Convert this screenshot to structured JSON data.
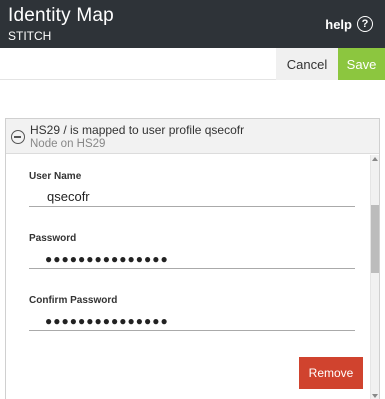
{
  "header": {
    "title": "Identity Map",
    "subtitle": "STITCH",
    "help_label": "help",
    "help_icon": "question-circle-icon"
  },
  "actions": {
    "cancel_label": "Cancel",
    "save_label": "Save",
    "save_color": "#8cc63f"
  },
  "mapping": {
    "title": "HS29 / is mapped to user profile qsecofr",
    "subtitle": "Node on HS29",
    "collapse_icon": "minus-circle-icon",
    "fields": {
      "username_label": "User Name",
      "username_value": "qsecofr",
      "password_label": "Password",
      "password_value": "●●●●●●●●●●●●●●●",
      "confirm_label": "Confirm Password",
      "confirm_value": "●●●●●●●●●●●●●●●"
    },
    "remove_label": "Remove",
    "remove_color": "#d0432e"
  }
}
